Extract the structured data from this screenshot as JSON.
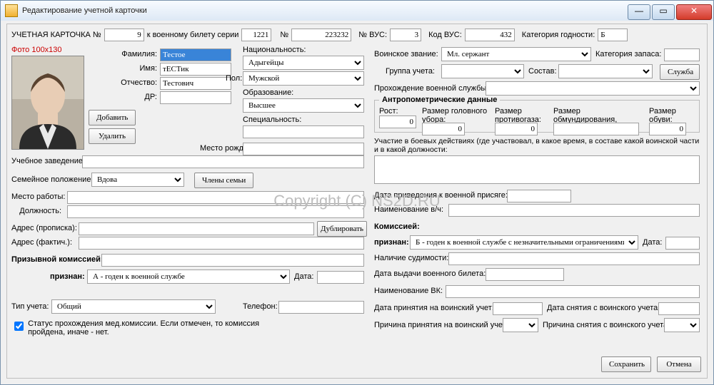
{
  "window": {
    "title": "Редактирование учетной карточки",
    "minimize": "—",
    "maximize": "▭",
    "close": "✕"
  },
  "watermark": "Copyright (C) NS2D.RU",
  "topbar": {
    "card_lbl": "УЧЕТНАЯ КАРТОЧКА №",
    "card_no": "9",
    "series_lbl": "к военному билету серии",
    "series": "1221",
    "num_lbl": "№",
    "num": "223232",
    "vus_lbl": "№ ВУС:",
    "vus": "3",
    "codevus_lbl": "Код ВУС:",
    "codevus": "432",
    "cat_lbl": "Категория годности:",
    "cat": "Б"
  },
  "photo_lbl": "Фото 100x130",
  "btn_add": "Добавить",
  "btn_del": "Удалить",
  "fio": {
    "last_lbl": "Фамилия:",
    "last": "Тестое",
    "first_lbl": "Имя:",
    "first": "тЕСТик",
    "mid_lbl": "Отчество:",
    "mid": "Тестович",
    "dr_lbl": "ДР:",
    "dr": ""
  },
  "personal": {
    "nat_lbl": "Национальность:",
    "nat": "Адыгейцы",
    "sex_lbl": "Пол:",
    "sex": "Мужской",
    "edu_lbl": "Образование:",
    "edu": "Высшее",
    "spec_lbl": "Специальность:",
    "spec": "",
    "birthplace_lbl": "Место рожд:",
    "birthplace": ""
  },
  "edu_inst_lbl": "Учебное заведение:",
  "edu_inst": "",
  "family": {
    "status_lbl": "Семейное положение:",
    "status": "Вдова",
    "members_btn": "Члены семьи"
  },
  "work": {
    "place_lbl": "Место работы:",
    "place": "",
    "post_lbl": "Должность:",
    "post": ""
  },
  "addr": {
    "reg_lbl": "Адрес (прописка):",
    "reg": "",
    "fact_lbl": "Адрес (фактич.):",
    "fact": "",
    "dup_btn": "Дублировать"
  },
  "draft": {
    "comm_lbl": "Призывной комиссией:",
    "comm": "",
    "recog_lbl": "признан:",
    "recog": "А - годен к военной службе",
    "date_lbl": "Дата:",
    "date": ""
  },
  "acct": {
    "type_lbl": "Тип учета:",
    "type": "Общий",
    "phone_lbl": "Телефон:",
    "phone": ""
  },
  "med": {
    "text": "Статус прохождения мед.комиссии. Если отмечен, то комиссия пройдена, иначе - нет.",
    "checked": true
  },
  "svc": {
    "rank_lbl": "Воинское звание:",
    "rank": "Мл. сержант",
    "reserve_lbl": "Категория запаса:",
    "reserve": "",
    "group_lbl": "Группа учета:",
    "group": "",
    "sostav_lbl": "Состав:",
    "sostav": "",
    "service_btn": "Служба",
    "pass_lbl": "Прохождение военной службы:",
    "pass": ""
  },
  "anthro": {
    "legend": "Антропометрические данные",
    "height_lbl": "Рост:",
    "height": "0",
    "head_lbl": "Размер головного убора:",
    "head": "0",
    "mask_lbl": "Размер противогаза:",
    "mask": "0",
    "uniform_lbl": "Размер обмундирования, ростовка:",
    "uniform": "",
    "shoes_lbl": "Размер обуви:",
    "shoes": "0"
  },
  "combat": {
    "lbl": "Участие в боевых действиях (где участвовал, в какое время, в составе какой воинской части и в какой должности:",
    "val": ""
  },
  "oath": {
    "date_lbl": "Дата приведения к военной присяге:",
    "date": "",
    "unit_lbl": "Наименование в/ч:",
    "unit": ""
  },
  "comm2": {
    "hdr": "Комиссией:",
    "recog_lbl": "признан:",
    "recog": "Б - годен к военной службе с незначительными ограничениями",
    "date_lbl": "Дата:",
    "date": "",
    "convict_lbl": "Наличие судимости:",
    "convict": "",
    "ticket_date_lbl": "Дата выдачи военного билета:",
    "ticket_date": "",
    "vk_lbl": "Наименование ВК:",
    "vk": "",
    "reg_date_lbl": "Дата принятия на воинский учет:",
    "reg_date": "",
    "dereg_date_lbl": "Дата снятия с воинского учета:",
    "dereg_date": "",
    "reg_reason_lbl": "Причина принятия на воинский учет:",
    "reg_reason": "",
    "dereg_reason_lbl": "Причина снятия с воинского учета:",
    "dereg_reason": ""
  },
  "footer": {
    "save": "Сохранить",
    "cancel": "Отмена"
  }
}
